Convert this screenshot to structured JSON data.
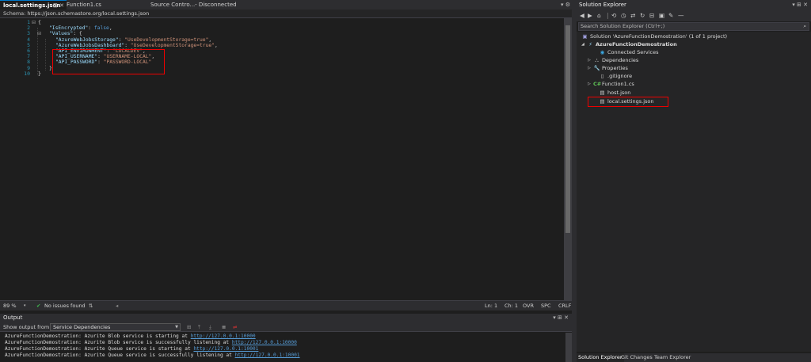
{
  "tabs": [
    {
      "label": "local.settings.json",
      "active": true
    },
    {
      "label": "Function1.cs",
      "active": false
    },
    {
      "label": "Source Contro...- Disconnected",
      "active": false
    }
  ],
  "schema": {
    "label": "Schema:",
    "value": "https://json.schemastore.org/local.settings.json"
  },
  "editor": {
    "line_numbers": [
      "1",
      "2",
      "3",
      "4",
      "5",
      "6",
      "7",
      "8",
      "9",
      "10"
    ],
    "lines": [
      [
        {
          "t": "p",
          "v": "{"
        }
      ],
      [
        {
          "t": "k",
          "v": "\"IsEncrypted\""
        },
        {
          "t": "p",
          "v": ": "
        },
        {
          "t": "b",
          "v": "false"
        },
        {
          "t": "p",
          "v": ","
        }
      ],
      [
        {
          "t": "k",
          "v": "\"Values\""
        },
        {
          "t": "p",
          "v": ": {"
        }
      ],
      [
        {
          "t": "k",
          "v": "\"AzureWebJobsStorage\""
        },
        {
          "t": "p",
          "v": ": "
        },
        {
          "t": "s",
          "v": "\"UseDevelopmentStorage=true\""
        },
        {
          "t": "p",
          "v": ","
        }
      ],
      [
        {
          "t": "k",
          "v": "\"AzureWebJobsDashboard\""
        },
        {
          "t": "p",
          "v": ": "
        },
        {
          "t": "s",
          "v": "\"UseDevelopmentStorage=true\""
        },
        {
          "t": "p",
          "v": ","
        }
      ],
      [
        {
          "t": "k",
          "v": "\"API_ENVIRONMENT\""
        },
        {
          "t": "p",
          "v": ": "
        },
        {
          "t": "s",
          "v": "\"LOCALDEV\""
        },
        {
          "t": "p",
          "v": ","
        }
      ],
      [
        {
          "t": "k",
          "v": "\"API_USERNAME\""
        },
        {
          "t": "p",
          "v": ": "
        },
        {
          "t": "s",
          "v": "\"USERNAME-LOCAL\""
        },
        {
          "t": "p",
          "v": ","
        }
      ],
      [
        {
          "t": "k",
          "v": "\"API_PASSWORD\""
        },
        {
          "t": "p",
          "v": ": "
        },
        {
          "t": "s",
          "v": "\"PASSWORD-LOCAL\""
        }
      ],
      [
        {
          "t": "p",
          "v": "}"
        }
      ],
      [
        {
          "t": "p",
          "v": "}"
        }
      ]
    ]
  },
  "editor_status": {
    "zoom": "89 %",
    "issues": "No issues found",
    "line": "Ln: 1",
    "col": "Ch: 1",
    "ovr": "OVR",
    "spc": "SPC",
    "crlf": "CRLF"
  },
  "output": {
    "title": "Output",
    "show_from_label": "Show output from:",
    "selected_source": "Service Dependencies",
    "lines": [
      {
        "text": "AzureFunctionDemostration: Azurite Blob service is starting at ",
        "link": "http://127.0.0.1:10000"
      },
      {
        "text": "AzureFunctionDemostration: Azurite Blob service is successfully listening at ",
        "link": "http://127.0.0.1:10000"
      },
      {
        "text": "AzureFunctionDemostration: Azurite Queue service is starting at ",
        "link": "http://127.0.0.1:10001"
      },
      {
        "text": "AzureFunctionDemostration: Azurite Queue service is successfully listening at ",
        "link": "http://127.0.0.1:10001"
      }
    ]
  },
  "solution_explorer": {
    "title": "Solution Explorer",
    "search_placeholder": "Search Solution Explorer (Ctrl+;)",
    "solution_label": "Solution 'AzureFunctionDemostration' (1 of 1 project)",
    "project": "AzureFunctionDemostration",
    "items": [
      {
        "label": "Connected Services",
        "icon": "connected-services-icon"
      },
      {
        "label": "Dependencies",
        "icon": "dependencies-icon"
      },
      {
        "label": "Properties",
        "icon": "wrench-icon"
      },
      {
        "label": ".gitignore",
        "icon": "file-icon"
      },
      {
        "label": "Function1.cs",
        "icon": "csharp-file-icon"
      },
      {
        "label": "host.json",
        "icon": "json-file-icon"
      },
      {
        "label": "local.settings.json",
        "icon": "json-file-icon"
      }
    ],
    "bottom_tabs": [
      "Solution Explorer",
      "Git Changes",
      "Team Explorer"
    ]
  },
  "colors": {
    "accent": "#007acc",
    "highlight": "#e00000",
    "key": "#9cdcfe",
    "string": "#ce9178"
  }
}
